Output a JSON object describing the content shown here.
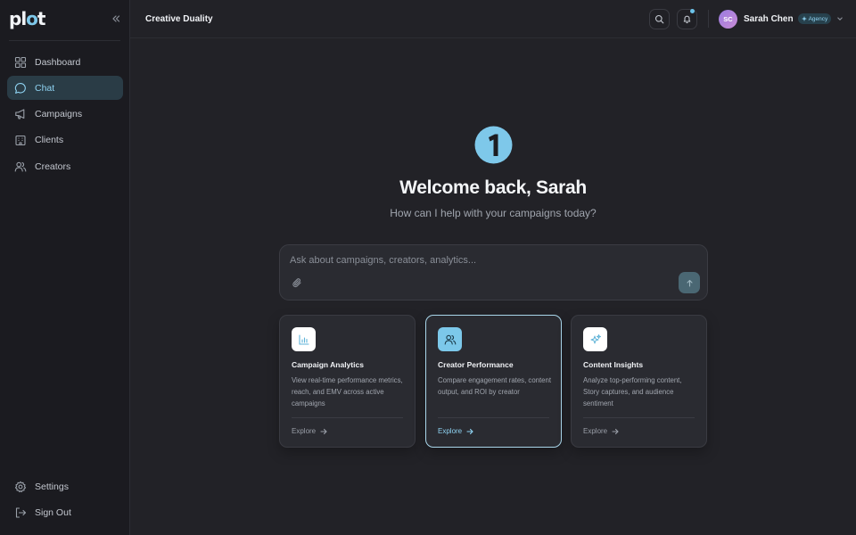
{
  "brand": {
    "logo_text_a": "pl",
    "logo_text_o": "o",
    "logo_text_b": "t"
  },
  "sidebar": {
    "items": [
      {
        "label": "Dashboard",
        "icon": "grid-icon",
        "active": false
      },
      {
        "label": "Chat",
        "icon": "chat-bubble-icon",
        "active": true
      },
      {
        "label": "Campaigns",
        "icon": "megaphone-icon",
        "active": false
      },
      {
        "label": "Clients",
        "icon": "building-icon",
        "active": false
      },
      {
        "label": "Creators",
        "icon": "users-icon",
        "active": false
      }
    ],
    "bottom_items": [
      {
        "label": "Settings",
        "icon": "gear-icon"
      },
      {
        "label": "Sign Out",
        "icon": "sign-out-icon"
      }
    ]
  },
  "header": {
    "workspace_title": "Creative Duality",
    "user": {
      "initials": "SC",
      "name": "Sarah Chen",
      "badge": "Agency"
    },
    "has_notification": true
  },
  "main": {
    "welcome": "Welcome back, Sarah",
    "subtitle": "How can I help with your campaigns today?",
    "chat": {
      "placeholder": "Ask about campaigns, creators, analytics..."
    },
    "cards": [
      {
        "title": "Campaign Analytics",
        "description": "View real-time performance metrics, reach, and EMV across active campaigns",
        "cta": "Explore",
        "icon": "bar-chart-icon"
      },
      {
        "title": "Creator Performance",
        "description": "Compare engagement rates, content output, and ROI by creator",
        "cta": "Explore",
        "icon": "users-icon"
      },
      {
        "title": "Content Insights",
        "description": "Analyze top-performing content, Story captures, and audience sentiment",
        "cta": "Explore",
        "icon": "sparkle-icon"
      }
    ]
  },
  "colors": {
    "accent": "#7ec8ea",
    "background": "#222227",
    "sidebar": "#1b1b20",
    "active_nav": "#2a3c46"
  }
}
